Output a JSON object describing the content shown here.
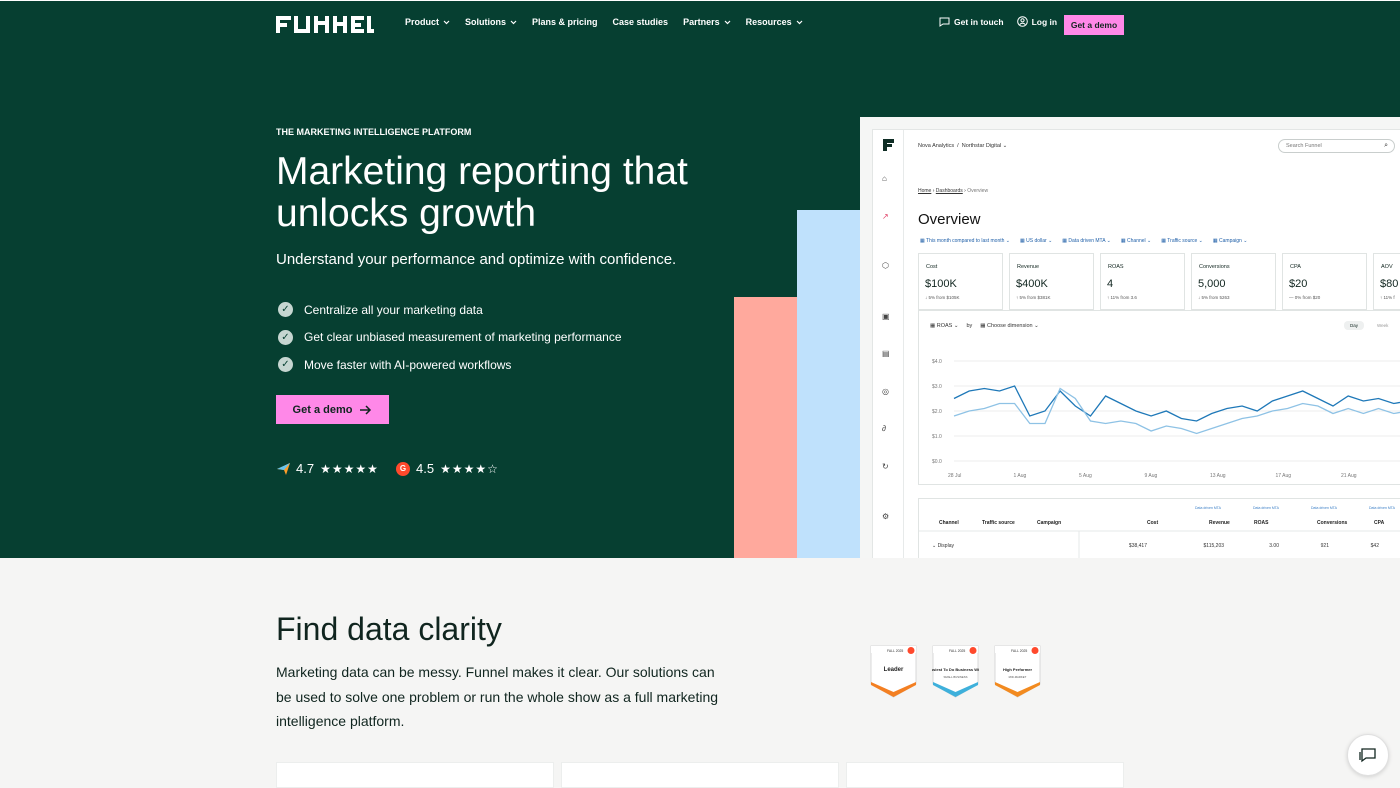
{
  "nav": {
    "brand": "FUNNEL",
    "items": [
      {
        "label": "Product",
        "has_dropdown": true
      },
      {
        "label": "Solutions",
        "has_dropdown": true
      },
      {
        "label": "Plans & pricing",
        "has_dropdown": false
      },
      {
        "label": "Case studies",
        "has_dropdown": false
      },
      {
        "label": "Partners",
        "has_dropdown": true
      },
      {
        "label": "Resources",
        "has_dropdown": true
      }
    ],
    "get_in_touch": "Get in touch",
    "log_in": "Log in",
    "get_demo": "Get a demo"
  },
  "hero": {
    "eyebrow": "THE MARKETING INTELLIGENCE PLATFORM",
    "headline": "Marketing reporting that unlocks growth",
    "subtitle": "Understand your performance and optimize with confidence.",
    "bullets": [
      "Centralize all your marketing data",
      "Get clear unbiased measurement of marketing performance",
      "Move faster with AI-powered workflows"
    ],
    "cta": "Get a demo",
    "ratings": [
      {
        "value": "4.7",
        "icon": "capterra-icon",
        "stars": "★★★★★"
      },
      {
        "value": "4.5",
        "icon": "g2-icon",
        "stars": "★★★★☆"
      }
    ]
  },
  "dashboard": {
    "breadcrumb_top": [
      "Nova Analytics",
      "Northstar Digital"
    ],
    "search_placeholder": "Search Funnel",
    "breadcrumb": [
      "Home",
      "Dashboards",
      "Overview"
    ],
    "title": "Overview",
    "filters": [
      "This month compared to last month",
      "US dollar",
      "Data driven MTA",
      "Channel",
      "Traffic source",
      "Campaign"
    ],
    "kpis": [
      {
        "label": "Cost",
        "value": "$100K",
        "change": "↓ 5% from $105K"
      },
      {
        "label": "Revenue",
        "value": "$400K",
        "change": "↑ 5% from $381K"
      },
      {
        "label": "ROAS",
        "value": "4",
        "change": "↑ 11% from 3.6"
      },
      {
        "label": "Conversions",
        "value": "5,000",
        "change": "↓ 5% from 5263"
      },
      {
        "label": "CPA",
        "value": "$20",
        "change": "— 0% from $20"
      },
      {
        "label": "AOV",
        "value": "$80",
        "change": "↑ 11% f"
      }
    ],
    "chart_controls": {
      "metric": "ROAS",
      "by": "by",
      "dimension": "Choose dimension",
      "toggle_active": "Day",
      "toggle_inactive": "Week"
    },
    "chart_data": {
      "type": "line",
      "x": [
        "28 Jul",
        "1 Aug",
        "5 Aug",
        "9 Aug",
        "13 Aug",
        "17 Aug",
        "21 Aug"
      ],
      "ylabel": "",
      "yticks": [
        "$0.0",
        "$1.0",
        "$2.0",
        "$3.0",
        "$4.0"
      ],
      "ylim": [
        0,
        4
      ],
      "series": [
        {
          "values": [
            2.5,
            2.8,
            2.9,
            2.8,
            3.0,
            1.8,
            2.0,
            2.8,
            2.2,
            1.8,
            2.6,
            2.3,
            2.0,
            1.8,
            2.0,
            1.7,
            1.6,
            1.9,
            2.1,
            2.2,
            2.0,
            2.4,
            2.6,
            2.8,
            2.5,
            2.2,
            2.6,
            2.4,
            2.5,
            2.3,
            2.4,
            2.3
          ],
          "color": "#1e78b8"
        },
        {
          "values": [
            1.8,
            2.0,
            2.1,
            2.3,
            2.3,
            1.5,
            1.5,
            2.9,
            2.5,
            1.6,
            1.5,
            1.6,
            1.5,
            1.2,
            1.4,
            1.3,
            1.1,
            1.3,
            1.5,
            1.7,
            1.8,
            2.0,
            2.1,
            2.3,
            2.2,
            1.9,
            2.1,
            1.9,
            2.1,
            1.9,
            2.0,
            1.9
          ],
          "color": "#8ec2e5"
        }
      ]
    },
    "table": {
      "headers": [
        "Channel",
        "Traffic source",
        "Campaign",
        "Cost",
        "Revenue",
        "ROAS",
        "Conversions",
        "CPA"
      ],
      "group_labels": [
        "Data driven MTA",
        "Data driven MTA",
        "Data driven MTA",
        "Data driven MTA"
      ],
      "rows": [
        {
          "label": "Display",
          "values": [
            "$38,417",
            "$115,203",
            "3.00",
            "921",
            "$42"
          ]
        },
        {
          "label": "Direct",
          "values": [
            "-",
            "$28,552",
            "-",
            "1174",
            "-"
          ]
        }
      ]
    }
  },
  "section": {
    "title": "Find data clarity",
    "text": "Marketing data can be messy. Funnel makes it clear. Our solutions can be used to solve one problem or run the whole show as a full marketing intelligence platform.",
    "badges": [
      {
        "top": "FALL 2025",
        "main": "Leader",
        "sub": "",
        "color": "#f37f22"
      },
      {
        "top": "FALL 2025",
        "main": "Easiest To Do Business With",
        "sub": "SMALL BUSINESS",
        "color": "#3eb0db"
      },
      {
        "top": "FALL 2025",
        "main": "High Performer",
        "sub": "MID-MARKET",
        "color": "#f28a1f"
      }
    ]
  },
  "colors": {
    "hero": "#063f31",
    "accent": "#ff88e8",
    "salmon": "#ffa99d",
    "lightblue": "#bfe1fc"
  }
}
